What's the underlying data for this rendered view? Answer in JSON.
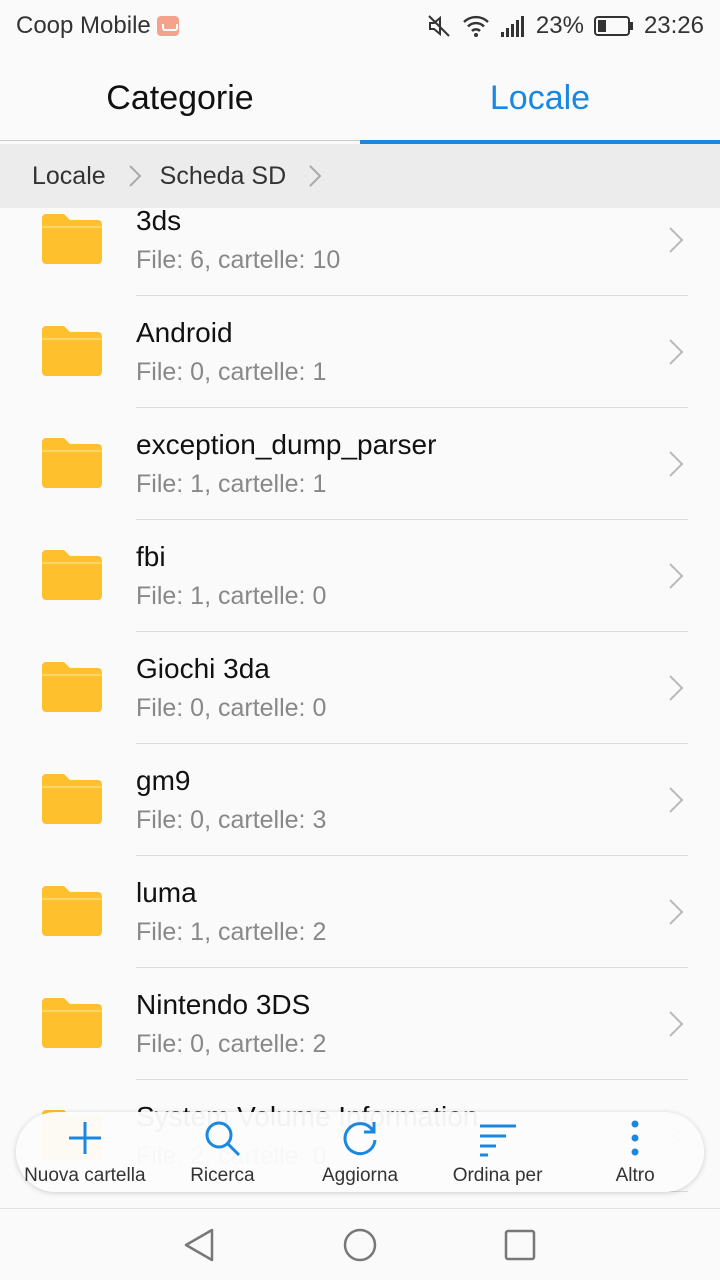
{
  "status_bar": {
    "carrier": "Coop Mobile",
    "battery": "23%",
    "time": "23:26",
    "icons": [
      "sim-icon",
      "mute-icon",
      "wifi-icon",
      "signal-icon",
      "battery-icon"
    ]
  },
  "tabs": [
    {
      "label": "Categorie",
      "active": false
    },
    {
      "label": "Locale",
      "active": true
    }
  ],
  "accent_color": "#1a88e0",
  "folder_color": "#ffc02e",
  "breadcrumb": [
    {
      "label": "Locale"
    },
    {
      "label": "Scheda SD"
    }
  ],
  "files": [
    {
      "name": "3ds",
      "meta": "File: 6, cartelle: 10"
    },
    {
      "name": "Android",
      "meta": "File: 0, cartelle: 1"
    },
    {
      "name": "exception_dump_parser",
      "meta": "File: 1, cartelle: 1"
    },
    {
      "name": "fbi",
      "meta": "File: 1, cartelle: 0"
    },
    {
      "name": "Giochi 3da",
      "meta": "File: 0, cartelle: 0"
    },
    {
      "name": "gm9",
      "meta": "File: 0, cartelle: 3"
    },
    {
      "name": "luma",
      "meta": "File: 1, cartelle: 2"
    },
    {
      "name": "Nintendo 3DS",
      "meta": "File: 0, cartelle: 2"
    },
    {
      "name": "System Volume Information",
      "meta": "File: 2, cartelle: 0"
    }
  ],
  "toolbar": [
    {
      "label": "Nuova cartella",
      "icon": "plus-icon"
    },
    {
      "label": "Ricerca",
      "icon": "search-icon"
    },
    {
      "label": "Aggiorna",
      "icon": "refresh-icon"
    },
    {
      "label": "Ordina per",
      "icon": "sort-icon"
    },
    {
      "label": "Altro",
      "icon": "more-vertical-icon"
    }
  ],
  "nav_bar": [
    "back-icon",
    "home-icon",
    "recents-icon"
  ]
}
